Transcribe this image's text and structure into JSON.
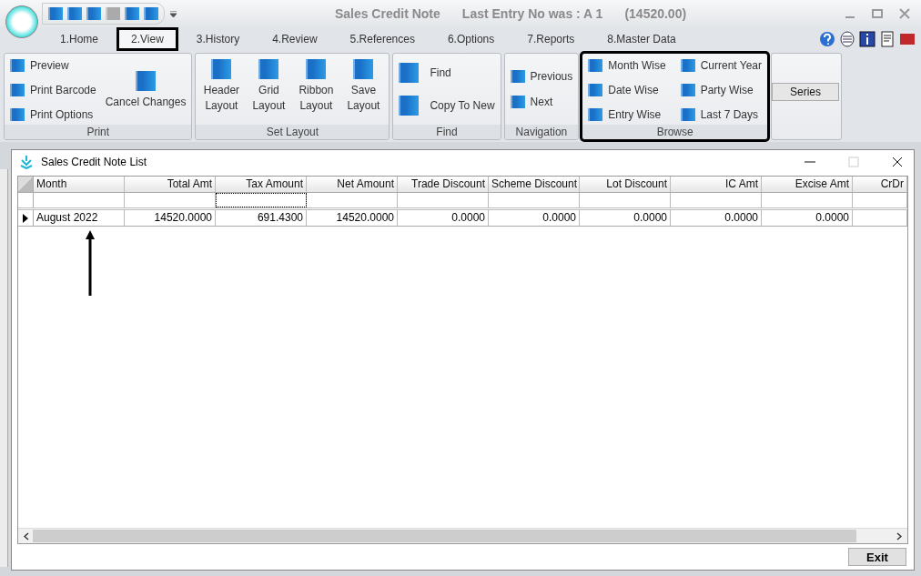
{
  "app": {
    "title": "Sales Credit Note",
    "last_entry": "Last Entry No was : A 1",
    "amount": "(14520.00)"
  },
  "quick_access": [
    {
      "disabled": false
    },
    {
      "disabled": false
    },
    {
      "disabled": false
    },
    {
      "disabled": true
    },
    {
      "disabled": false
    },
    {
      "disabled": false
    }
  ],
  "tabs": [
    {
      "label": "1.Home",
      "selected": false,
      "highlighted": false
    },
    {
      "label": "2.View",
      "selected": true,
      "highlighted": true
    },
    {
      "label": "3.History",
      "selected": false,
      "highlighted": false
    },
    {
      "label": "4.Review",
      "selected": false,
      "highlighted": false
    },
    {
      "label": "5.References",
      "selected": false,
      "highlighted": false
    },
    {
      "label": "6.Options",
      "selected": false,
      "highlighted": false
    },
    {
      "label": "7.Reports",
      "selected": false,
      "highlighted": false
    },
    {
      "label": "8.Master Data",
      "selected": false,
      "highlighted": false
    }
  ],
  "ribbon": [
    {
      "title": "Print",
      "kind": "print",
      "highlighted": false,
      "items": [
        {
          "label": "Preview",
          "kind": "small"
        },
        {
          "label": "Print Barcode",
          "kind": "small"
        },
        {
          "label": "Print Options",
          "kind": "small"
        },
        {
          "label": "Cancel Changes",
          "kind": "large"
        }
      ]
    },
    {
      "title": "Set Layout",
      "kind": "row",
      "highlighted": false,
      "items": [
        {
          "label": "Header Layout",
          "kind": "large"
        },
        {
          "label": "Grid Layout",
          "kind": "large"
        },
        {
          "label": "Ribbon Layout",
          "kind": "large"
        },
        {
          "label": "Save Layout",
          "kind": "large"
        }
      ]
    },
    {
      "title": "Find",
      "kind": "column",
      "highlighted": false,
      "items": [
        {
          "label": "Find",
          "kind": "medium"
        },
        {
          "label": "Copy To New",
          "kind": "medium"
        }
      ]
    },
    {
      "title": "Navigation",
      "kind": "column",
      "highlighted": false,
      "items": [
        {
          "label": "Previous",
          "kind": "small"
        },
        {
          "label": "Next",
          "kind": "small"
        }
      ]
    },
    {
      "title": "Browse",
      "kind": "grid",
      "highlighted": true,
      "items": [
        {
          "label": "Month Wise",
          "kind": "small"
        },
        {
          "label": "Current Year",
          "kind": "small"
        },
        {
          "label": "Date Wise",
          "kind": "small"
        },
        {
          "label": "Party Wise",
          "kind": "small"
        },
        {
          "label": "Entry Wise",
          "kind": "small"
        },
        {
          "label": "Last 7 Days",
          "kind": "small"
        }
      ]
    },
    {
      "kind": "column",
      "highlighted": false,
      "items": [
        {
          "label": "Series",
          "kind": "button"
        }
      ]
    }
  ],
  "list_window": {
    "title": "Sales Credit Note List",
    "columns": [
      "Month",
      "Total Amt",
      "Tax Amount",
      "Net Amount",
      "Trade Discount",
      "Scheme Discount",
      "Lot Discount",
      "IC Amt",
      "Excise Amt",
      "CrDr"
    ],
    "rows": [
      {
        "current": true,
        "cells": [
          "August 2022",
          "14520.0000",
          "691.4300",
          "14520.0000",
          "0.0000",
          "0.0000",
          "0.0000",
          "0.0000",
          "0.0000",
          ""
        ]
      }
    ],
    "arrow_annotation": true,
    "exit_button": "Exit"
  }
}
